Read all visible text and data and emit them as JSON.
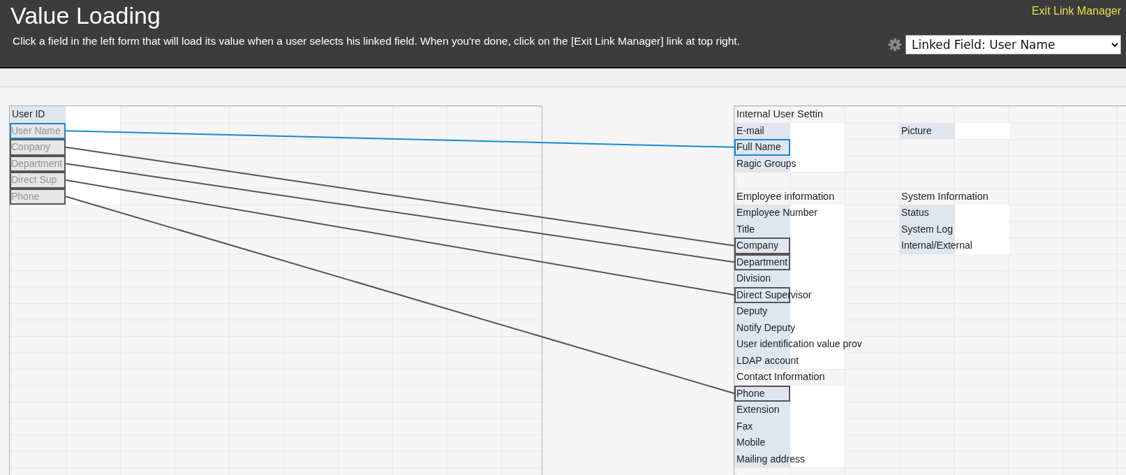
{
  "header": {
    "title": "Value Loading",
    "instructions": "Click a field in the left form that will load its value when a user selects his linked field. When you're done, click on the [Exit Link Manager] link at top right.",
    "exit_link": "Exit Link Manager",
    "linked_field_select": "Linked Field: User Name"
  },
  "source_form": {
    "fields": [
      {
        "label": "User ID",
        "linked": false,
        "selected": false
      },
      {
        "label": "User Name",
        "linked": true,
        "selected": true
      },
      {
        "label": "Conpany",
        "linked": true,
        "selected": false
      },
      {
        "label": "Department",
        "linked": true,
        "selected": false
      },
      {
        "label": "Direct Sup",
        "linked": true,
        "selected": false
      },
      {
        "label": "Phone",
        "linked": true,
        "selected": false
      }
    ]
  },
  "target_form": {
    "rows": [
      {
        "kind": "row",
        "cells": [
          {
            "kind": "heading",
            "text": "Internal User Settin"
          }
        ]
      },
      {
        "kind": "row",
        "cells": [
          {
            "kind": "field",
            "label": "E-mail",
            "linked": false,
            "selected": false
          },
          {
            "kind": "field",
            "label": "Picture",
            "linked": false,
            "selected": false
          }
        ]
      },
      {
        "kind": "row",
        "cells": [
          {
            "kind": "field",
            "label": "Full Name",
            "linked": true,
            "selected": true
          }
        ]
      },
      {
        "kind": "row",
        "cells": [
          {
            "kind": "field",
            "label": "Ragic Groups",
            "linked": false,
            "selected": false
          }
        ]
      },
      {
        "kind": "blank"
      },
      {
        "kind": "row",
        "cells": [
          {
            "kind": "heading",
            "text": "Employee information"
          },
          {
            "kind": "heading",
            "text": "System Information"
          }
        ]
      },
      {
        "kind": "row",
        "cells": [
          {
            "kind": "field",
            "label": "Employee Number",
            "linked": false,
            "selected": false
          },
          {
            "kind": "field",
            "label": "Status",
            "linked": false,
            "selected": false
          }
        ]
      },
      {
        "kind": "row",
        "cells": [
          {
            "kind": "field",
            "label": "Title",
            "linked": false,
            "selected": false
          },
          {
            "kind": "field",
            "label": "System Log",
            "linked": false,
            "selected": false
          }
        ]
      },
      {
        "kind": "row",
        "cells": [
          {
            "kind": "field",
            "label": "Company",
            "linked": true,
            "selected": false
          },
          {
            "kind": "field",
            "label": "Internal/External",
            "linked": false,
            "selected": false
          }
        ]
      },
      {
        "kind": "row",
        "cells": [
          {
            "kind": "field",
            "label": "Department",
            "linked": true,
            "selected": false
          }
        ]
      },
      {
        "kind": "row",
        "cells": [
          {
            "kind": "field",
            "label": "Division",
            "linked": false,
            "selected": false
          }
        ]
      },
      {
        "kind": "row",
        "cells": [
          {
            "kind": "field",
            "label": "Direct Supervisor",
            "linked": true,
            "selected": false
          }
        ]
      },
      {
        "kind": "row",
        "cells": [
          {
            "kind": "field",
            "label": "Deputy",
            "linked": false,
            "selected": false
          }
        ]
      },
      {
        "kind": "row",
        "cells": [
          {
            "kind": "field",
            "label": "Notify Deputy",
            "linked": false,
            "selected": false
          }
        ]
      },
      {
        "kind": "row",
        "cells": [
          {
            "kind": "field",
            "label": "User identification value prov",
            "linked": false,
            "selected": false
          }
        ]
      },
      {
        "kind": "row",
        "cells": [
          {
            "kind": "field",
            "label": "LDAP account",
            "linked": false,
            "selected": false
          }
        ]
      },
      {
        "kind": "row",
        "cells": [
          {
            "kind": "heading",
            "text": "Contact Information"
          }
        ]
      },
      {
        "kind": "row",
        "cells": [
          {
            "kind": "field",
            "label": "Phone",
            "linked": true,
            "selected": false
          }
        ]
      },
      {
        "kind": "row",
        "cells": [
          {
            "kind": "field",
            "label": "Extension",
            "linked": false,
            "selected": false
          }
        ]
      },
      {
        "kind": "row",
        "cells": [
          {
            "kind": "field",
            "label": "Fax",
            "linked": false,
            "selected": false
          }
        ]
      },
      {
        "kind": "row",
        "cells": [
          {
            "kind": "field",
            "label": "Mobile",
            "linked": false,
            "selected": false
          }
        ]
      },
      {
        "kind": "row",
        "cells": [
          {
            "kind": "field",
            "label": "Mailing address",
            "linked": false,
            "selected": false
          }
        ]
      }
    ]
  }
}
